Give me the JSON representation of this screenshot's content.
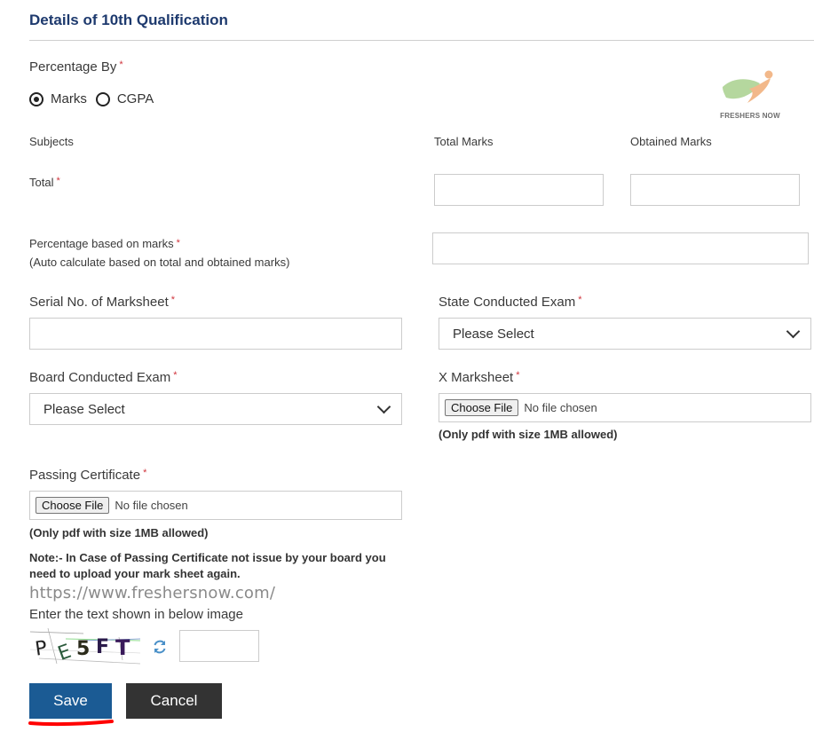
{
  "section": {
    "title": "Details of 10th Qualification"
  },
  "percentage_by": {
    "label": "Percentage By",
    "required_mark": "*",
    "options": [
      {
        "label": "Marks",
        "selected": true
      },
      {
        "label": "CGPA",
        "selected": false
      }
    ]
  },
  "logo": {
    "text": "FRESHERS NOW",
    "icon": "freshersnow-logo-icon",
    "colors": {
      "leaf": "#a8d08d",
      "figure": "#f2b88a"
    }
  },
  "marks_table": {
    "headers": [
      "Subjects",
      "Total Marks",
      "Obtained Marks"
    ],
    "rows": [
      {
        "subject": "Total",
        "required_mark": "*",
        "total_marks": "",
        "obtained_marks": ""
      }
    ]
  },
  "percentage_field": {
    "label": "Percentage based on marks",
    "required_mark": "*",
    "sublabel": "(Auto calculate based on total and obtained marks)",
    "value": ""
  },
  "serial_no": {
    "label": "Serial No. of Marksheet",
    "required_mark": "*",
    "value": ""
  },
  "state_exam": {
    "label": "State Conducted Exam",
    "required_mark": "*",
    "selected": "Please Select"
  },
  "board_exam": {
    "label": "Board Conducted Exam",
    "required_mark": "*",
    "selected": "Please Select"
  },
  "x_marksheet": {
    "label": "X Marksheet",
    "required_mark": "*",
    "button": "Choose File",
    "status": "No file chosen",
    "hint": "(Only pdf with size 1MB allowed)"
  },
  "passing_certificate": {
    "label": "Passing Certificate",
    "required_mark": "*",
    "button": "Choose File",
    "status": "No file chosen",
    "hint": "(Only pdf with size 1MB allowed)",
    "note": "Note:- In Case of Passing Certificate not issue by your board you need to upload your mark sheet again."
  },
  "watermark": "https://www.freshersnow.com/",
  "captcha": {
    "label": "Enter the text shown in below image",
    "image_text": "PE5FT",
    "value": "",
    "refresh_icon": "refresh-icon"
  },
  "actions": {
    "save": "Save",
    "cancel": "Cancel"
  },
  "colors": {
    "title": "#1e3a6e",
    "required": "#d0343c",
    "save_bg": "#1b5b94",
    "cancel_bg": "#333333",
    "annotation": "#ff0000"
  }
}
